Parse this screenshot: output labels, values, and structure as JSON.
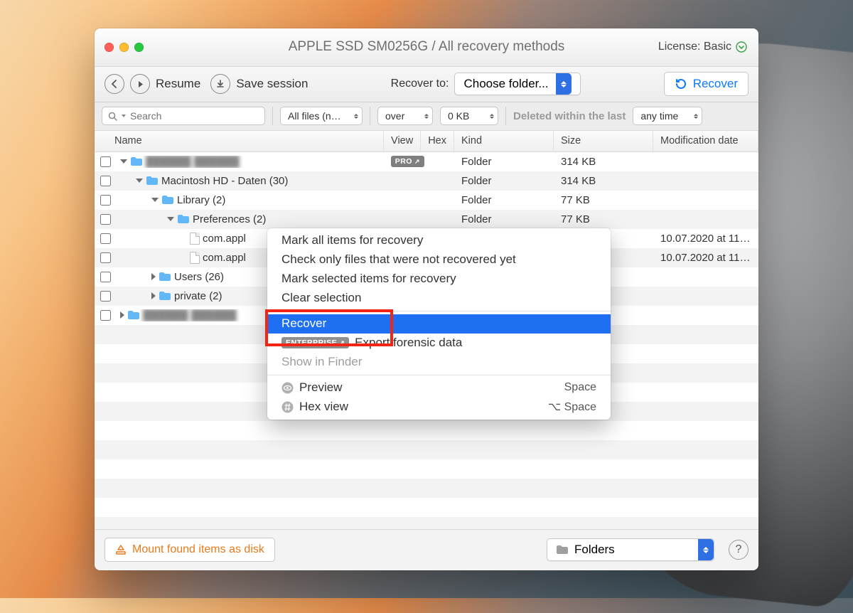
{
  "title": "APPLE SSD SM0256G / All recovery methods",
  "license": {
    "label": "License: Basic"
  },
  "toolbar": {
    "resume": "Resume",
    "save_session": "Save session",
    "recover_to": "Recover to:",
    "choose_folder": "Choose folder...",
    "recover": "Recover"
  },
  "filters": {
    "search_placeholder": "Search",
    "all_files": "All files (n…",
    "over": "over",
    "zero_kb": "0 KB",
    "deleted_within": "Deleted within the last",
    "any_time": "any time"
  },
  "columns": {
    "name": "Name",
    "view": "View",
    "hex": "Hex",
    "kind": "Kind",
    "size": "Size",
    "mod": "Modification date"
  },
  "rows": [
    {
      "indent": 0,
      "chevron": "down",
      "icon": "folder",
      "label": "",
      "blurred": true,
      "pro": true,
      "kind": "Folder",
      "size": "314 KB",
      "mod": ""
    },
    {
      "indent": 1,
      "chevron": "down",
      "icon": "folder",
      "label": "Macintosh HD - Daten (30)",
      "kind": "Folder",
      "size": "314 KB",
      "mod": ""
    },
    {
      "indent": 2,
      "chevron": "down",
      "icon": "folder",
      "label": "Library (2)",
      "kind": "Folder",
      "size": "77 KB",
      "mod": ""
    },
    {
      "indent": 3,
      "chevron": "down",
      "icon": "folder",
      "label": "Preferences (2)",
      "kind": "Folder",
      "size": "77 KB",
      "mod": ""
    },
    {
      "indent": 4,
      "chevron": "",
      "icon": "file",
      "label": "com.appl",
      "kind": "",
      "size": "",
      "mod": "10.07.2020 at 11…"
    },
    {
      "indent": 4,
      "chevron": "",
      "icon": "file",
      "label": "com.appl",
      "kind": "",
      "size": "",
      "mod": "10.07.2020 at 11…"
    },
    {
      "indent": 2,
      "chevron": "right",
      "icon": "folder",
      "label": "Users (26)",
      "kind": "",
      "size": "",
      "mod": ""
    },
    {
      "indent": 2,
      "chevron": "right",
      "icon": "folder",
      "label": "private (2)",
      "kind": "",
      "size": "",
      "mod": ""
    },
    {
      "indent": 0,
      "chevron": "right",
      "icon": "folder",
      "label": "",
      "blurred": true,
      "kind": "",
      "size": "",
      "mod": ""
    }
  ],
  "context_menu": {
    "mark_all": "Mark all items for recovery",
    "check_not_recovered": "Check only files that were not recovered yet",
    "mark_selected": "Mark selected items for recovery",
    "clear_selection": "Clear selection",
    "recover": "Recover",
    "export_forensic": "Export forensic data",
    "enterprise_badge": "ENTERPRISE",
    "show_in_finder": "Show in Finder",
    "preview": "Preview",
    "preview_shortcut": "Space",
    "hex_view": "Hex view",
    "hex_shortcut": "⌥ Space"
  },
  "statusbar": {
    "mount": "Mount found items as disk",
    "group_by": "Folders"
  }
}
